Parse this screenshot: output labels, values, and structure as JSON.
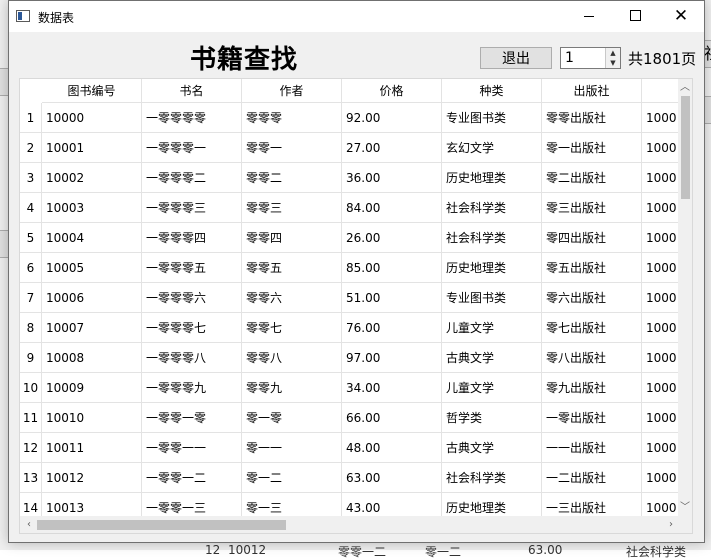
{
  "window": {
    "title": "数据表"
  },
  "heading": "书籍查找",
  "controls": {
    "exit_label": "退出",
    "page_value": "1",
    "total_label": "共1801页"
  },
  "table": {
    "columns": [
      "图书编号",
      "书名",
      "作者",
      "价格",
      "种类",
      "出版社",
      ""
    ],
    "rows": [
      {
        "num": "1",
        "cells": [
          "10000",
          "一零零零零",
          "零零零",
          "92.00",
          "专业图书类",
          "零零出版社",
          "1000"
        ]
      },
      {
        "num": "2",
        "cells": [
          "10001",
          "一零零零一",
          "零零一",
          "27.00",
          "玄幻文学",
          "零一出版社",
          "1000"
        ]
      },
      {
        "num": "3",
        "cells": [
          "10002",
          "一零零零二",
          "零零二",
          "36.00",
          "历史地理类",
          "零二出版社",
          "1000"
        ]
      },
      {
        "num": "4",
        "cells": [
          "10003",
          "一零零零三",
          "零零三",
          "84.00",
          "社会科学类",
          "零三出版社",
          "1000"
        ]
      },
      {
        "num": "5",
        "cells": [
          "10004",
          "一零零零四",
          "零零四",
          "26.00",
          "社会科学类",
          "零四出版社",
          "1000"
        ]
      },
      {
        "num": "6",
        "cells": [
          "10005",
          "一零零零五",
          "零零五",
          "85.00",
          "历史地理类",
          "零五出版社",
          "1000"
        ]
      },
      {
        "num": "7",
        "cells": [
          "10006",
          "一零零零六",
          "零零六",
          "51.00",
          "专业图书类",
          "零六出版社",
          "1000"
        ]
      },
      {
        "num": "8",
        "cells": [
          "10007",
          "一零零零七",
          "零零七",
          "76.00",
          "儿童文学",
          "零七出版社",
          "1000"
        ]
      },
      {
        "num": "9",
        "cells": [
          "10008",
          "一零零零八",
          "零零八",
          "97.00",
          "古典文学",
          "零八出版社",
          "1000"
        ]
      },
      {
        "num": "10",
        "cells": [
          "10009",
          "一零零零九",
          "零零九",
          "34.00",
          "儿童文学",
          "零九出版社",
          "1000"
        ]
      },
      {
        "num": "11",
        "cells": [
          "10010",
          "一零零一零",
          "零一零",
          "66.00",
          "哲学类",
          "一零出版社",
          "1000"
        ]
      },
      {
        "num": "12",
        "cells": [
          "10011",
          "一零零一一",
          "零一一",
          "48.00",
          "古典文学",
          "一一出版社",
          "1000"
        ]
      },
      {
        "num": "13",
        "cells": [
          "10012",
          "一零零一二",
          "零一二",
          "63.00",
          "社会科学类",
          "一二出版社",
          "1000"
        ]
      },
      {
        "num": "14",
        "cells": [
          "10013",
          "一零零一三",
          "零一三",
          "43.00",
          "历史地理类",
          "一三出版社",
          "1000"
        ]
      }
    ]
  },
  "background": {
    "row": [
      "12",
      "10012",
      "零零一二",
      "零一二",
      "63.00",
      "社会科学类"
    ],
    "side_button": "社"
  }
}
